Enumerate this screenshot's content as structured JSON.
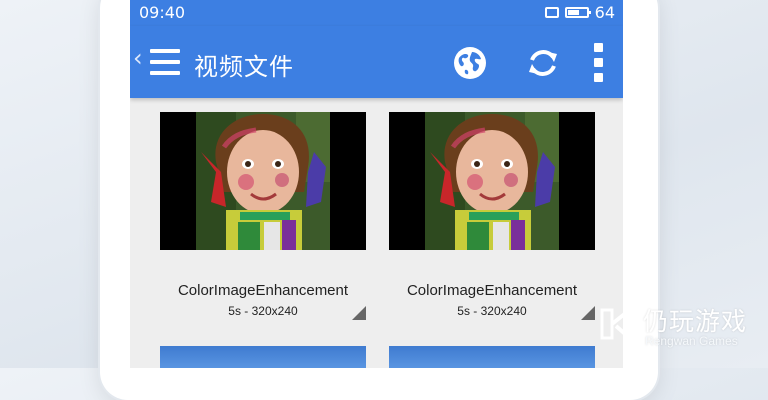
{
  "status_bar": {
    "time": "09:40",
    "battery_level": "64"
  },
  "app_bar": {
    "title": "视频文件",
    "icons": [
      "back-chevron-icon",
      "menu-icon",
      "globe-icon",
      "refresh-icon",
      "more-vert-icon"
    ]
  },
  "videos": [
    {
      "title": "ColorImageEnhancement",
      "meta": "5s - 320x240"
    },
    {
      "title": "ColorImageEnhancement",
      "meta": "5s - 320x240"
    }
  ],
  "watermark": {
    "name_cn": "仍玩游戏",
    "name_en": "Rengwan Games"
  },
  "colors": {
    "app_bar": "#3d7fe2",
    "list_background": "#eeeeee"
  }
}
